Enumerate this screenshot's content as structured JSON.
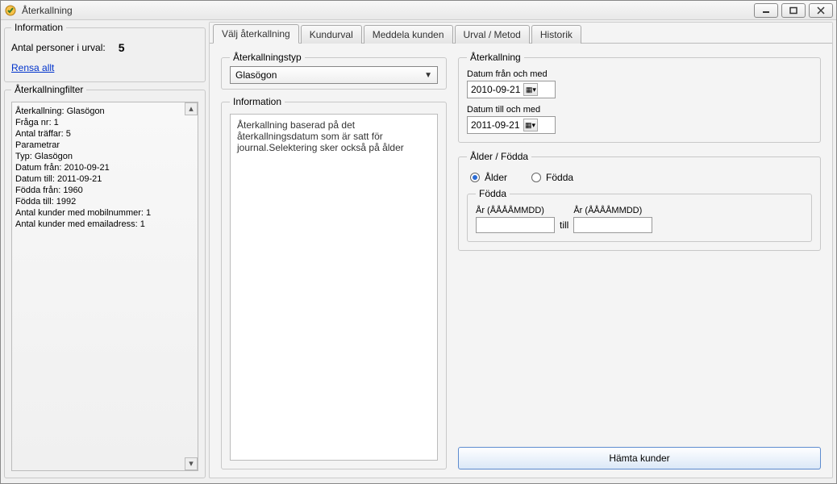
{
  "window": {
    "title": "Återkallning"
  },
  "left": {
    "info_title": "Information",
    "count_label": "Antal personer i urval:",
    "count_value": "5",
    "clear_label": "Rensa allt",
    "filter_title": "Återkallningfilter",
    "filter_lines": [
      "Återkallning: Glasögon",
      "Fråga nr: 1",
      "Antal träffar: 5",
      "Parametrar",
      "Typ: Glasögon",
      "Datum från: 2010-09-21",
      "Datum till: 2011-09-21",
      "Födda från: 1960",
      "Födda till: 1992",
      "Antal kunder med mobilnummer: 1",
      "Antal kunder med emailadress: 1"
    ]
  },
  "tabs": {
    "t1": "Välj återkallning",
    "t2": "Kundurval",
    "t3": "Meddela kunden",
    "t4": "Urval / Metod",
    "t5": "Historik"
  },
  "form": {
    "type_title": "Återkallningstyp",
    "type_selected": "Glasögon",
    "info_title": "Information",
    "info_text": "Återkallning baserad på det återkallningsdatum som är satt för journal.Selektering sker också på ålder",
    "recall_title": "Återkallning",
    "date_from_label": "Datum från och med",
    "date_from_value": "2010-09-21",
    "date_to_label": "Datum till och med",
    "date_to_value": "2011-09-21",
    "age_title": "Ålder / Födda",
    "radio_age": "Ålder",
    "radio_born": "Födda",
    "born_title": "Födda",
    "year_from_label": "År (ÅÅÅÅMMDD)",
    "year_to_label": "År (ÅÅÅÅMMDD)",
    "between_word": "till",
    "fetch_button": "Hämta kunder"
  }
}
